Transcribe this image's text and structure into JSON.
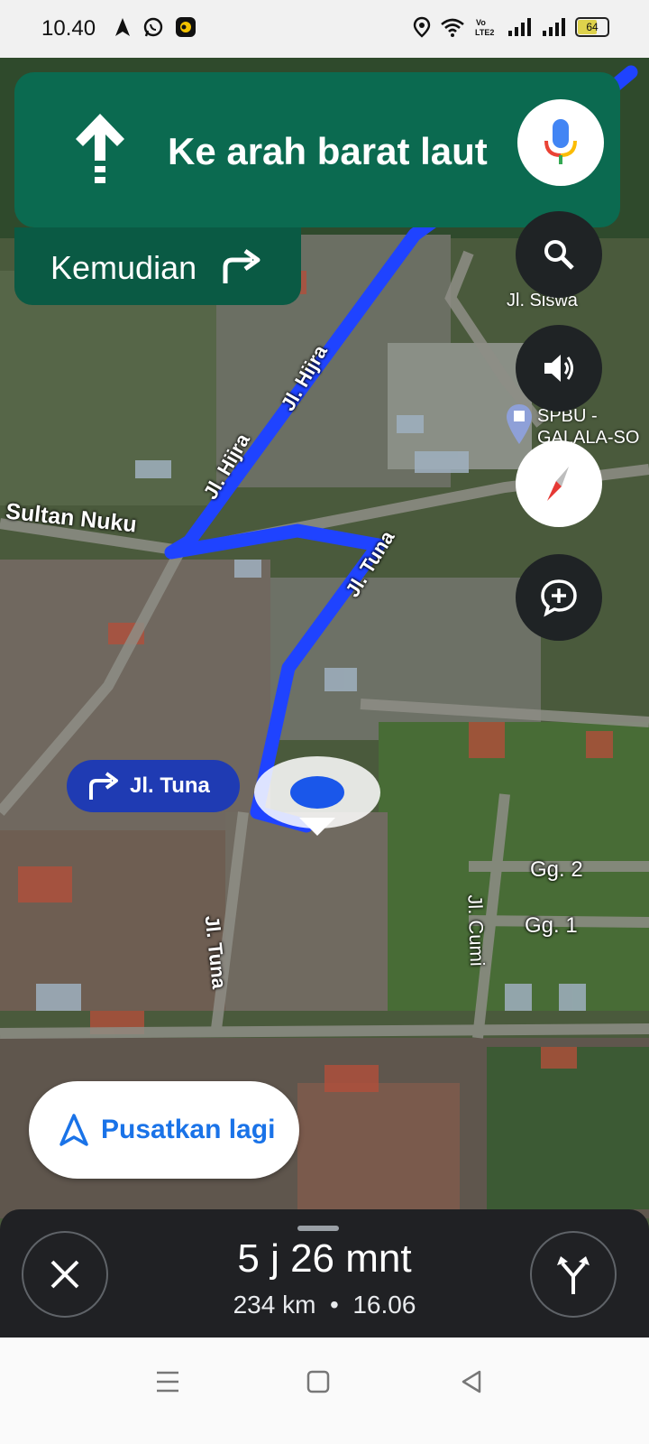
{
  "status_bar": {
    "time": "10.40",
    "battery": "64",
    "left_icons": [
      "navigation-icon",
      "whatsapp-icon",
      "app-icon"
    ],
    "right_icons": [
      "location-icon",
      "wifi-icon",
      "volte-icon",
      "signal-icon",
      "signal-icon"
    ]
  },
  "navigation": {
    "direction_text": "Ke arah barat laut",
    "then_label": "Kemudian",
    "turn_pill_label": "Jl. Tuna",
    "recenter_label": "Pusatkan lagi"
  },
  "map": {
    "labels": {
      "sultan_nuku": "Sultan Nuku",
      "hijra_1": "Jl. Hijra",
      "hijra_2": "Jl. Hijra",
      "tuna_top": "Jl. Tuna",
      "tuna_bottom": "Jl. Tuna",
      "siswa": "Jl. Siswa",
      "spbu_1": "SPBU -",
      "spbu_2": "GALALA-SO",
      "cumi": "Jl. Cumi",
      "gg2": "Gg. 2",
      "gg1": "Gg. 1"
    },
    "route_color": "#1f43ff"
  },
  "trip": {
    "duration": "5 j 26 mnt",
    "distance": "234 km",
    "separator": "•",
    "arrival": "16.06"
  },
  "colors": {
    "nav_green": "#0b6a50",
    "nav_green_dark": "#0a5a44",
    "accent_blue": "#1a73e8",
    "panel": "#202124"
  }
}
